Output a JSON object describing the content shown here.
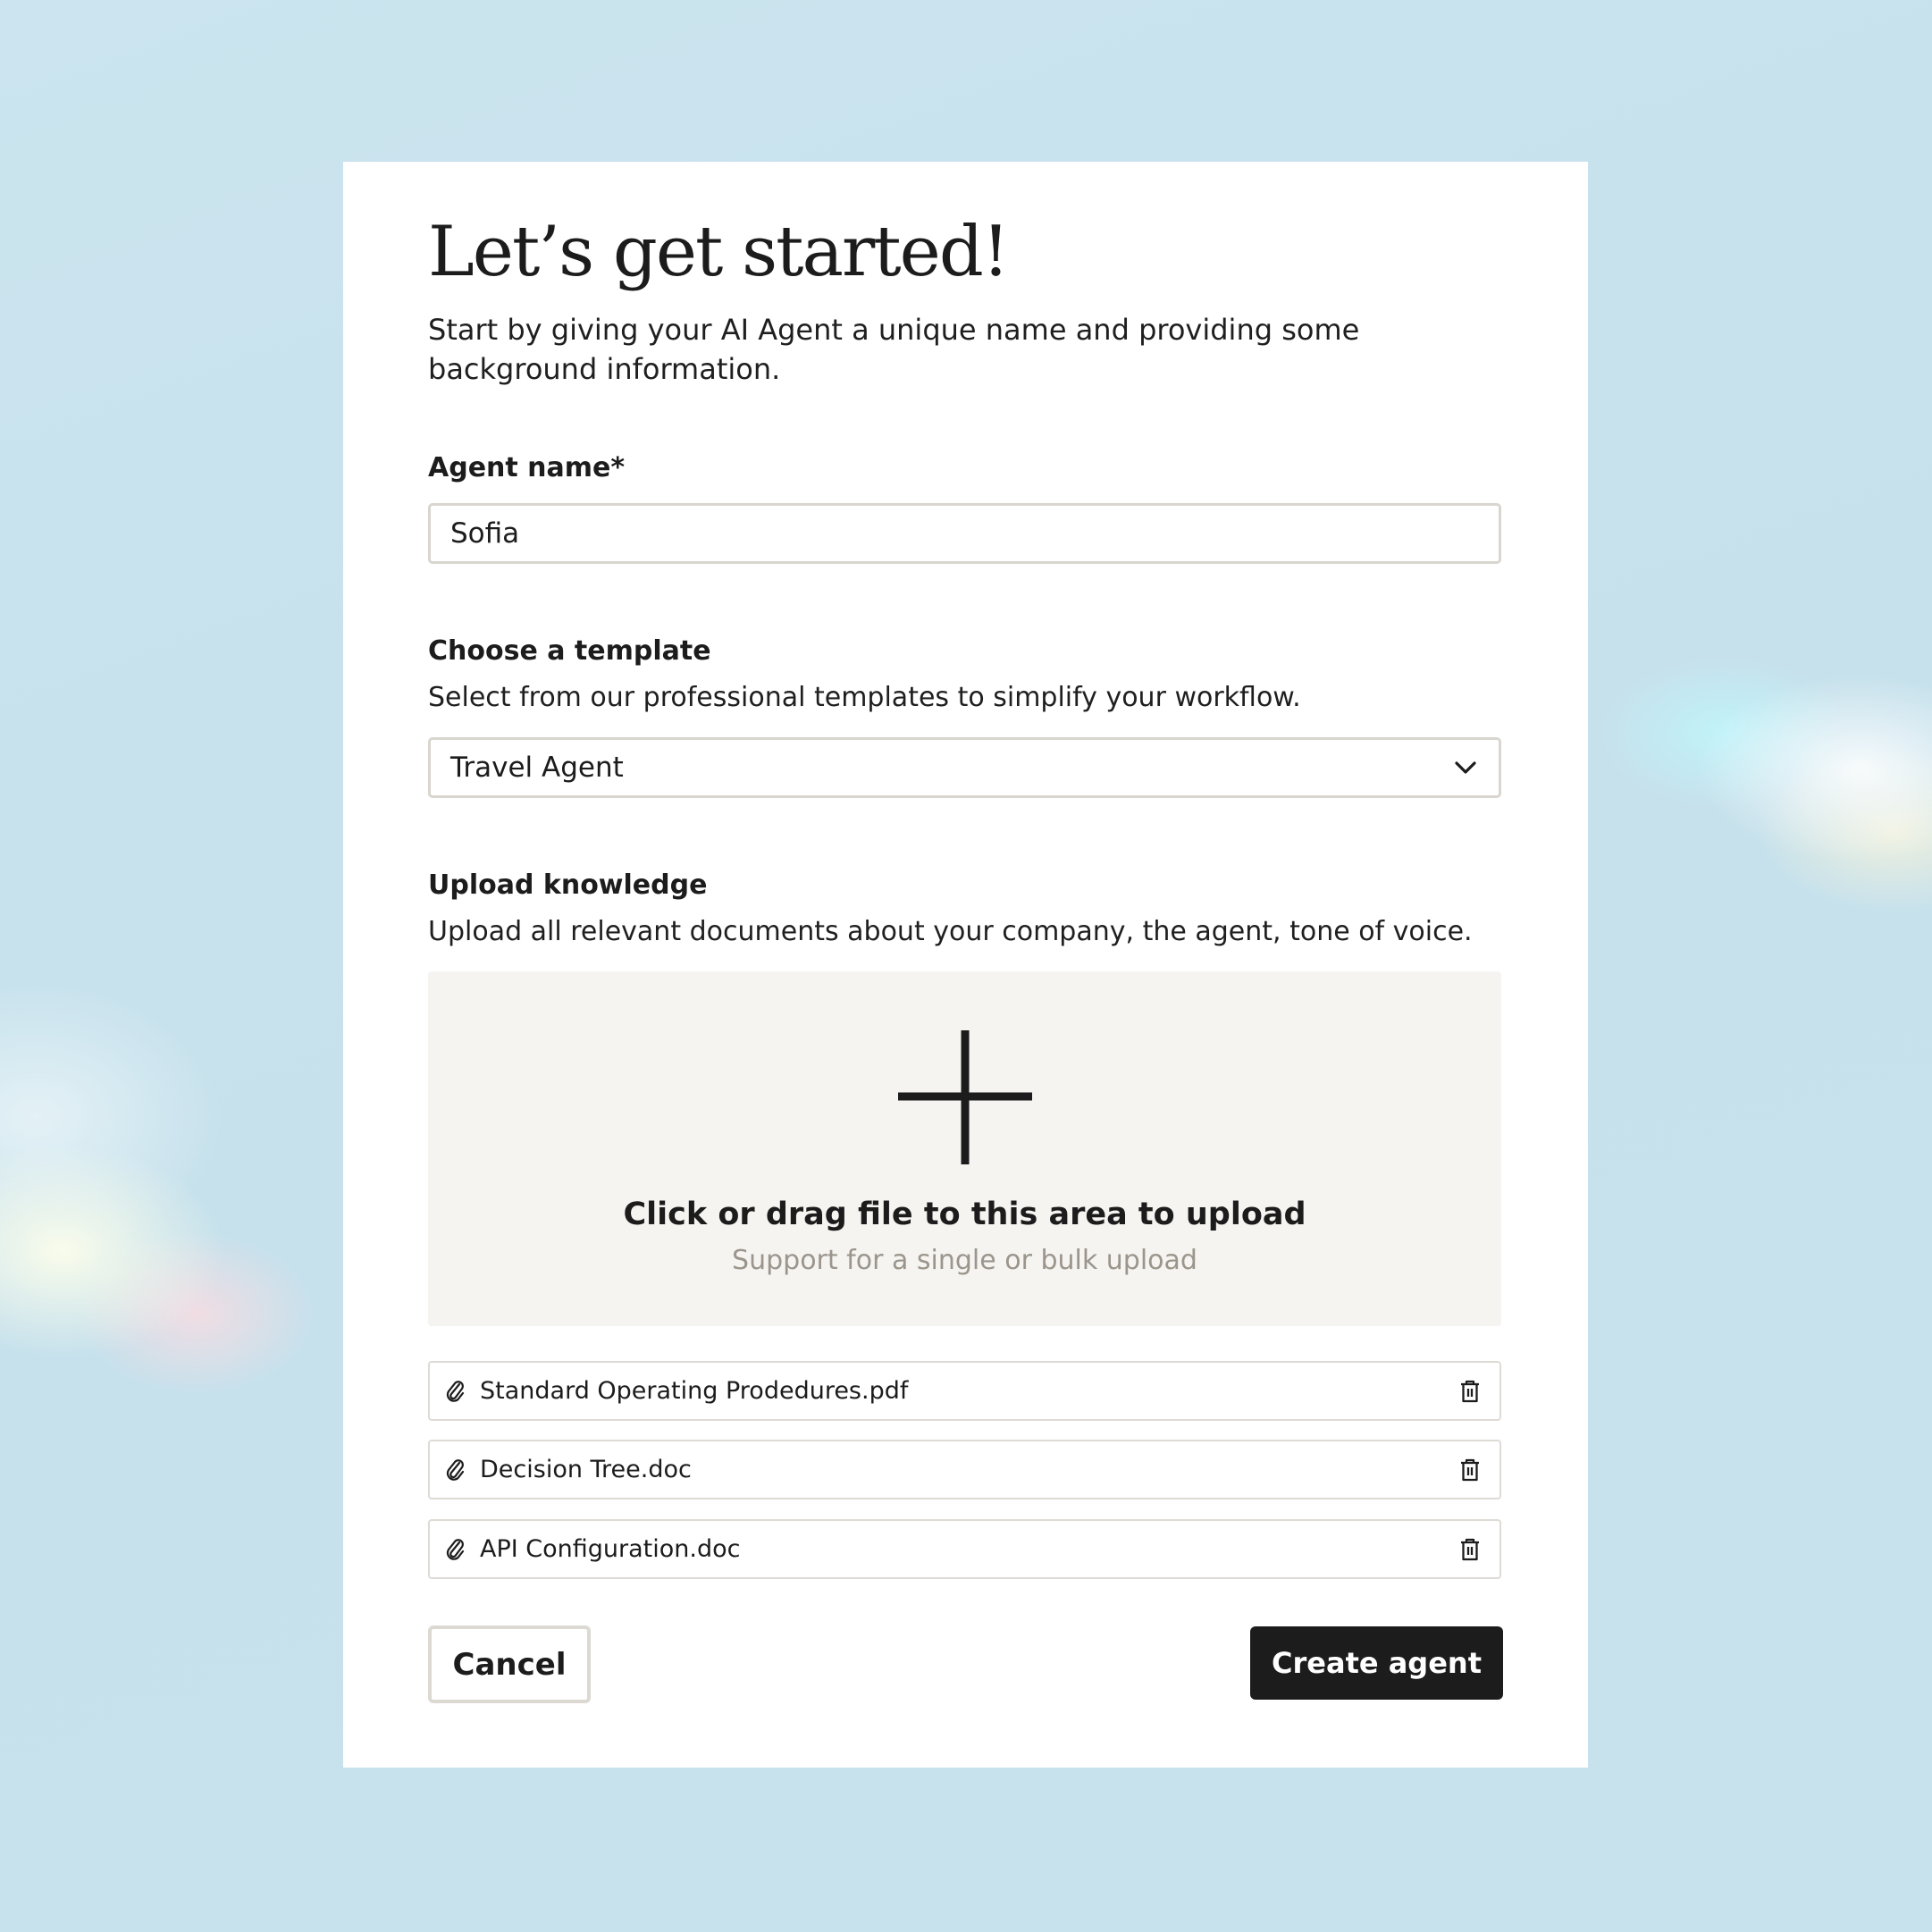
{
  "page": {
    "title": "Let’s get started!",
    "intro": "Start by giving your AI Agent a unique name and providing some background information."
  },
  "agent_name": {
    "label": "Agent name*",
    "value": "Sofia"
  },
  "template": {
    "label": "Choose a template",
    "help": "Select from our professional templates to simplify your workflow.",
    "selected": "Travel Agent",
    "icon": "chevron-down-icon"
  },
  "upload": {
    "label": "Upload knowledge",
    "help": "Upload all relevant documents about your company, the agent, tone of voice.",
    "dropzone_title": "Click or drag file to this area to upload",
    "dropzone_subtitle": "Support for a single or bulk upload",
    "icon": "plus-icon",
    "files": [
      {
        "name": "Standard Operating Prodedures.pdf"
      },
      {
        "name": "Decision Tree.doc"
      },
      {
        "name": "API Configuration.doc"
      }
    ]
  },
  "actions": {
    "cancel_label": "Cancel",
    "create_label": "Create agent"
  },
  "colors": {
    "background": "#c9e3ee",
    "card": "#ffffff",
    "primary_button": "#1c1c1c",
    "dropzone": "#f5f4f1",
    "muted_text": "#9b958c",
    "border": "#d9d6cf"
  }
}
